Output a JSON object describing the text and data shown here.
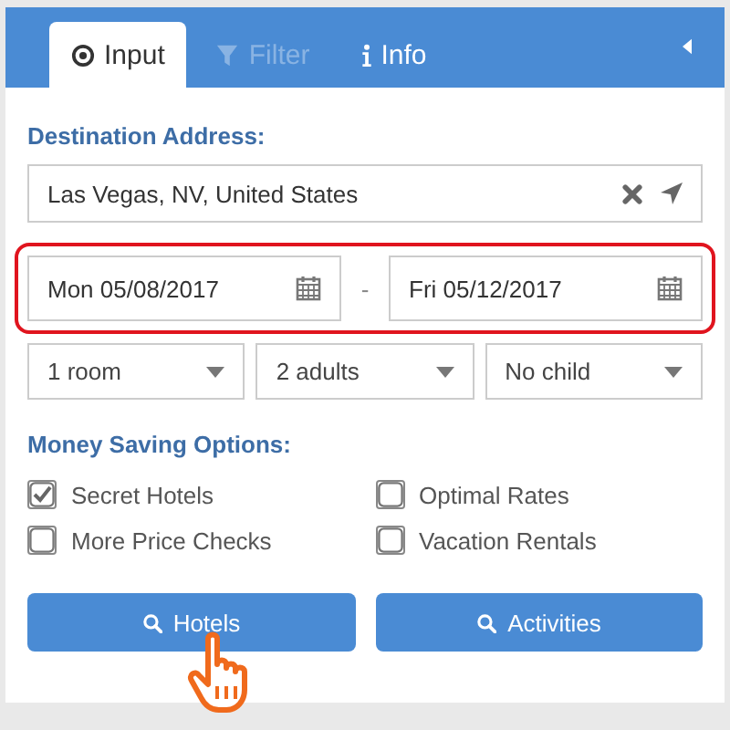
{
  "tabs": [
    {
      "label": "Input",
      "selected": true,
      "disabled": false
    },
    {
      "label": "Filter",
      "selected": false,
      "disabled": true
    },
    {
      "label": "Info",
      "selected": false,
      "disabled": false
    }
  ],
  "destination": {
    "label": "Destination Address:",
    "value": "Las Vegas, NV, United States"
  },
  "dates": {
    "start": "Mon 05/08/2017",
    "separator": "-",
    "end": "Fri 05/12/2017",
    "highlighted": true
  },
  "selects": [
    {
      "value": "1 room"
    },
    {
      "value": "2 adults"
    },
    {
      "value": "No child"
    }
  ],
  "savings": {
    "label": "Money Saving Options:",
    "options": [
      {
        "label": "Secret Hotels",
        "checked": true
      },
      {
        "label": "Optimal Rates",
        "checked": false
      },
      {
        "label": "More Price Checks",
        "checked": false
      },
      {
        "label": "Vacation Rentals",
        "checked": false
      }
    ]
  },
  "buttons": [
    {
      "label": "Hotels"
    },
    {
      "label": "Activities"
    }
  ]
}
